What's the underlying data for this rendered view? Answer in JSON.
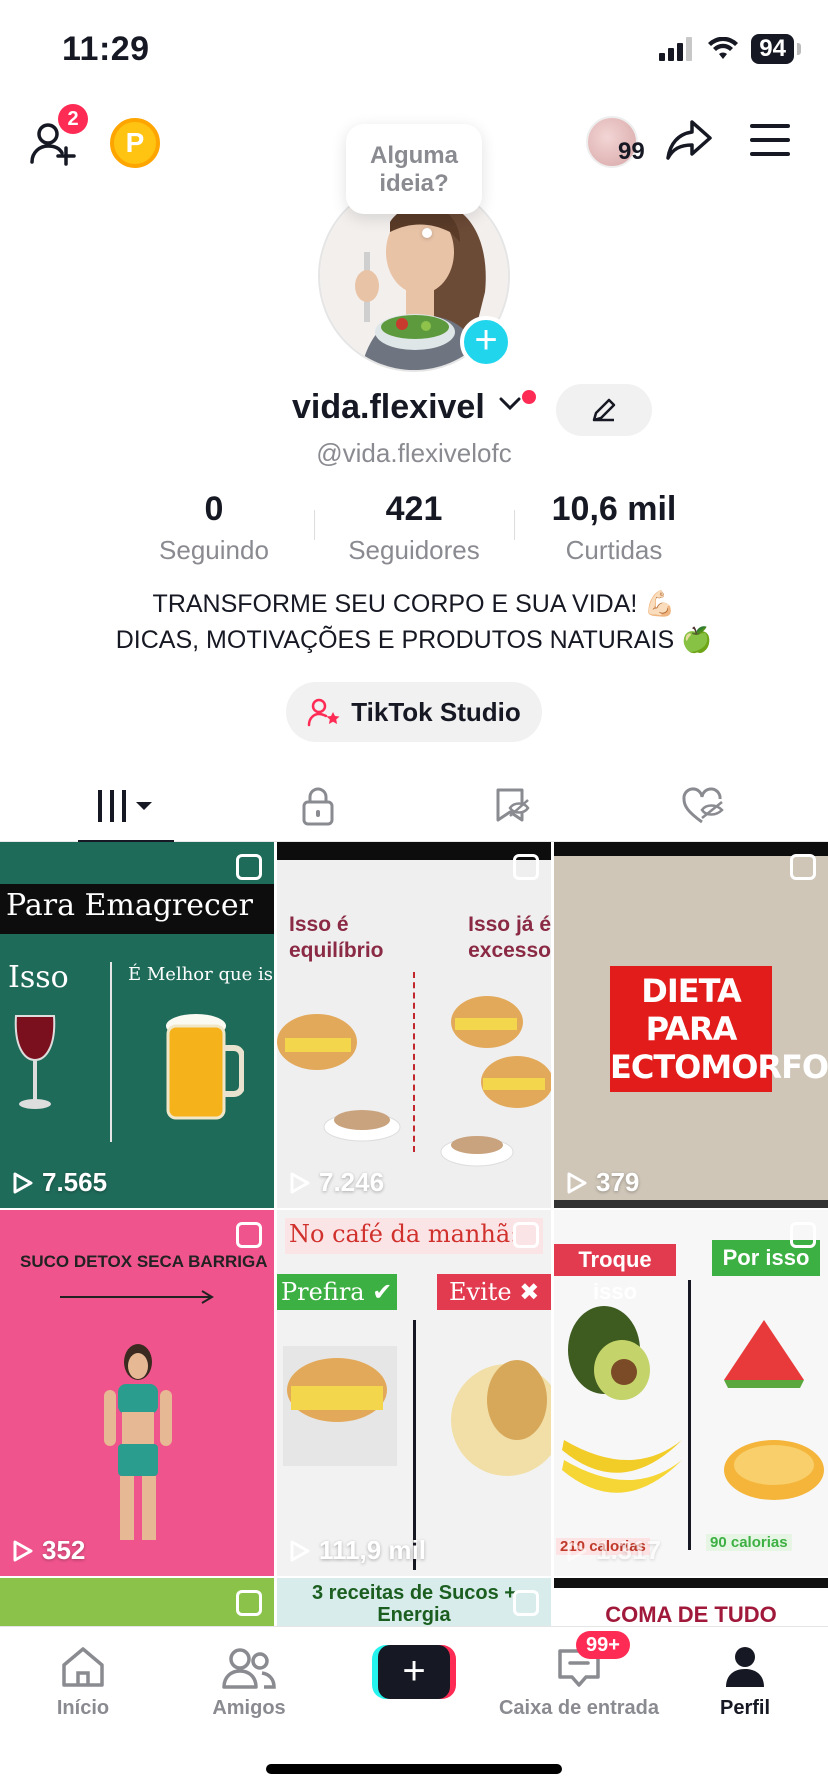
{
  "status": {
    "time": "11:29",
    "battery": "94"
  },
  "top": {
    "friend_badge": "2",
    "coin_letter": "P",
    "story_count": "99"
  },
  "profile": {
    "bubble": "Alguma ideia?",
    "username": "vida.flexivel",
    "handle": "@vida.flexivelofc",
    "stats": [
      {
        "value": "0",
        "label": "Seguindo"
      },
      {
        "value": "421",
        "label": "Seguidores"
      },
      {
        "value": "10,6 mil",
        "label": "Curtidas"
      }
    ],
    "bio_line1": "TRANSFORME SEU CORPO E SUA VIDA! 💪🏻",
    "bio_line2": "DICAS, MOTIVAÇÕES E PRODUTOS NATURAIS 🍏",
    "studio_label": "TikTok Studio"
  },
  "videos": [
    {
      "title": "Para Emagrecer",
      "left": "Isso",
      "right": "É Melhor que isso",
      "views": "7.565"
    },
    {
      "left": "Isso é equilíbrio",
      "right": "Isso já é excesso",
      "views": "7.246"
    },
    {
      "title": "DIETA PARA ECTOMORFO",
      "views": "379"
    },
    {
      "title": "SUCO DETOX SECA BARRIGA",
      "views": "352"
    },
    {
      "title": "No café da manhã:",
      "left": "Prefira ✔",
      "right": "Evite ✖",
      "views": "111,9 mil"
    },
    {
      "left": "Troque isso",
      "right": "Por isso",
      "left_cal": "210 calorias",
      "right_cal": "90 calorias",
      "views": "1.317"
    },
    {
      "views": ""
    },
    {
      "title": "3 receitas de Sucos + Energia",
      "views": ""
    },
    {
      "title": "COMA DE TUDO",
      "views": ""
    }
  ],
  "bottom_nav": {
    "home": "Início",
    "friends": "Amigos",
    "inbox": "Caixa de entrada",
    "inbox_badge": "99+",
    "profile": "Perfil"
  }
}
